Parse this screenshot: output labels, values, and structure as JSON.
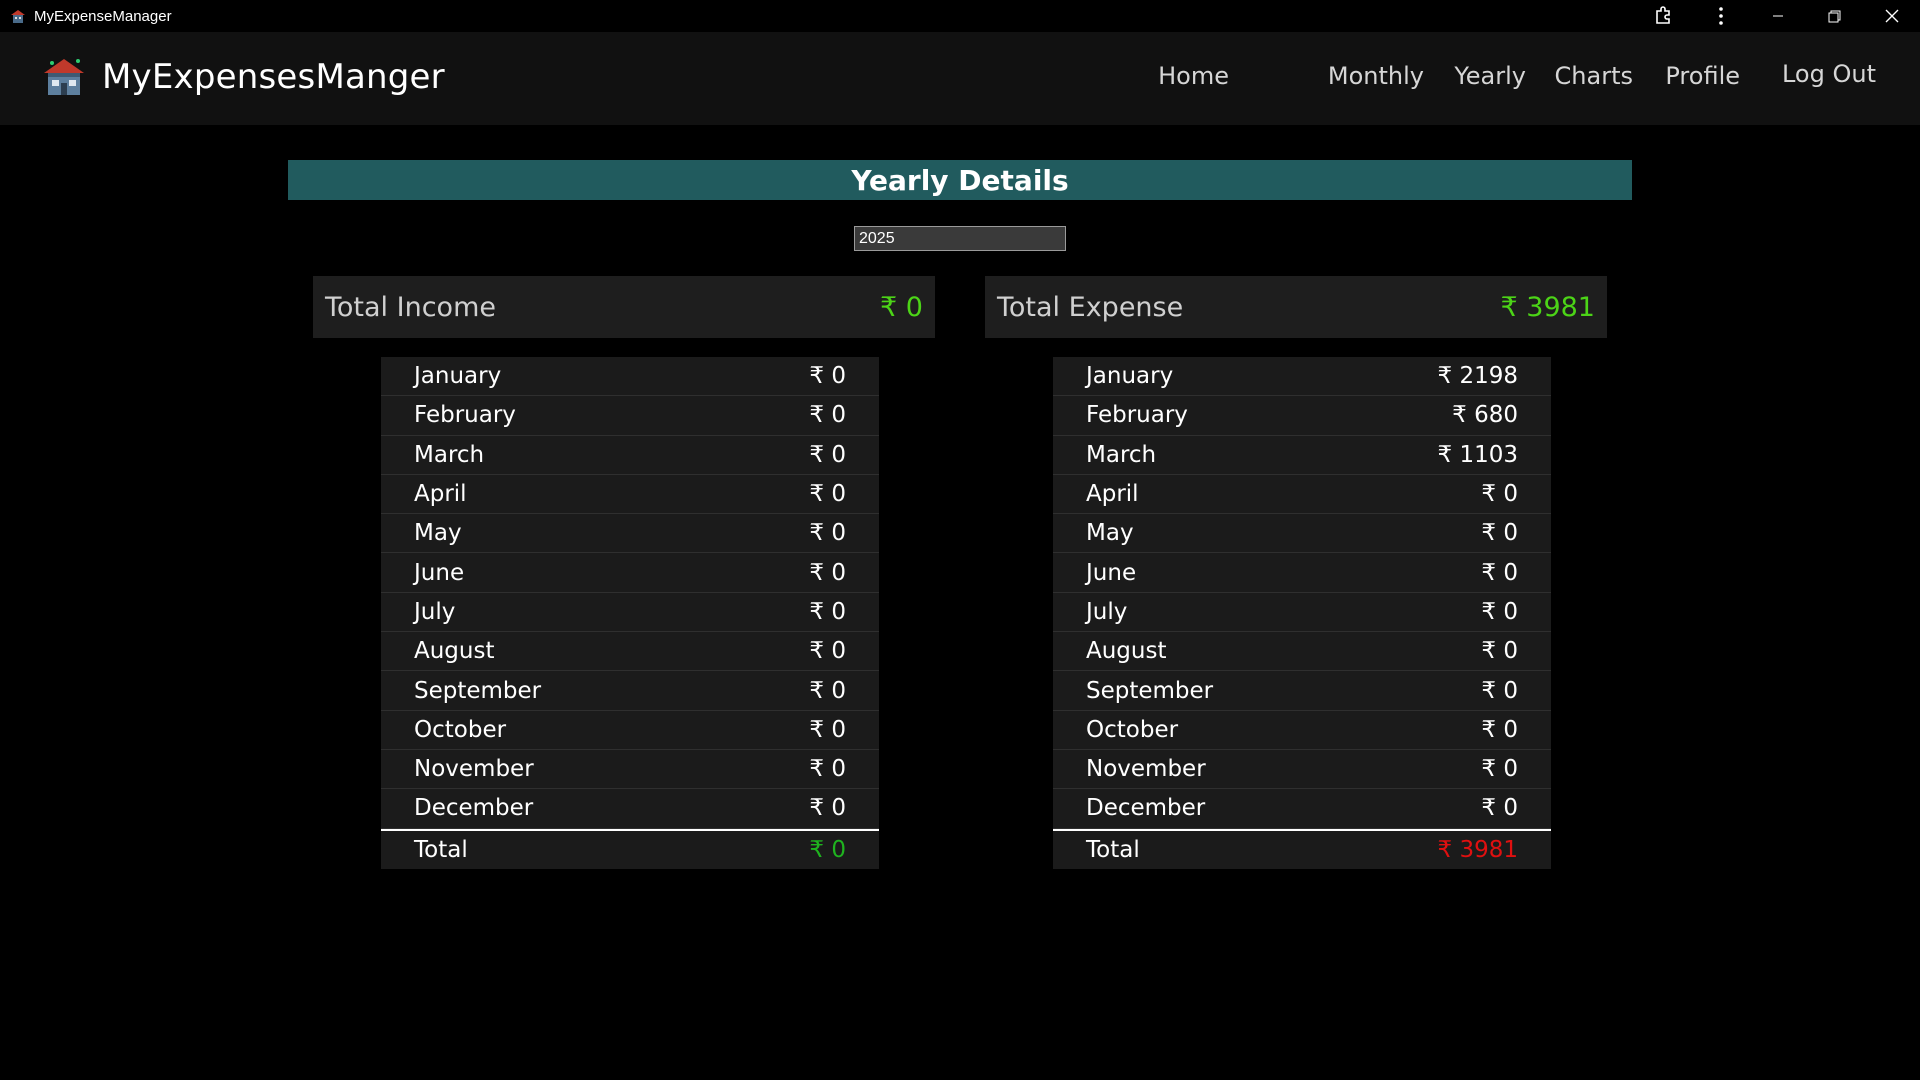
{
  "window": {
    "title": "MyExpenseManager"
  },
  "header": {
    "brand": "MyExpensesManger",
    "nav": [
      {
        "label": "Home"
      },
      {
        "label": "Monthly"
      },
      {
        "label": "Yearly"
      },
      {
        "label": "Charts"
      },
      {
        "label": "Profile"
      },
      {
        "label": "Log Out"
      }
    ]
  },
  "page": {
    "heading": "Yearly Details",
    "year_value": "2025"
  },
  "income": {
    "label": "Total Income",
    "amount": "₹ 0",
    "months": [
      {
        "month": "January",
        "value": "₹ 0"
      },
      {
        "month": "February",
        "value": "₹ 0"
      },
      {
        "month": "March",
        "value": "₹ 0"
      },
      {
        "month": "April",
        "value": "₹ 0"
      },
      {
        "month": "May",
        "value": "₹ 0"
      },
      {
        "month": "June",
        "value": "₹ 0"
      },
      {
        "month": "July",
        "value": "₹ 0"
      },
      {
        "month": "August",
        "value": "₹ 0"
      },
      {
        "month": "September",
        "value": "₹ 0"
      },
      {
        "month": "October",
        "value": "₹ 0"
      },
      {
        "month": "November",
        "value": "₹ 0"
      },
      {
        "month": "December",
        "value": "₹ 0"
      }
    ],
    "total_label": "Total",
    "total_value": "₹ 0",
    "total_color": "#1fb31f"
  },
  "expense": {
    "label": "Total Expense",
    "amount": "₹ 3981",
    "months": [
      {
        "month": "January",
        "value": "₹ 2198"
      },
      {
        "month": "February",
        "value": "₹ 680"
      },
      {
        "month": "March",
        "value": "₹ 1103"
      },
      {
        "month": "April",
        "value": "₹ 0"
      },
      {
        "month": "May",
        "value": "₹ 0"
      },
      {
        "month": "June",
        "value": "₹ 0"
      },
      {
        "month": "July",
        "value": "₹ 0"
      },
      {
        "month": "August",
        "value": "₹ 0"
      },
      {
        "month": "September",
        "value": "₹ 0"
      },
      {
        "month": "October",
        "value": "₹ 0"
      },
      {
        "month": "November",
        "value": "₹ 0"
      },
      {
        "month": "December",
        "value": "₹ 0"
      }
    ],
    "total_label": "Total",
    "total_value": "₹ 3981",
    "total_color": "#e01010"
  },
  "colors": {
    "heading_bg": "#215b5e",
    "summary_amount": "#4cd417"
  },
  "icons": {
    "app": "house-icon",
    "extensions": "extensions-icon",
    "more": "more-vertical-icon",
    "minimize": "minimize-icon",
    "restore": "restore-icon",
    "close": "close-icon"
  }
}
